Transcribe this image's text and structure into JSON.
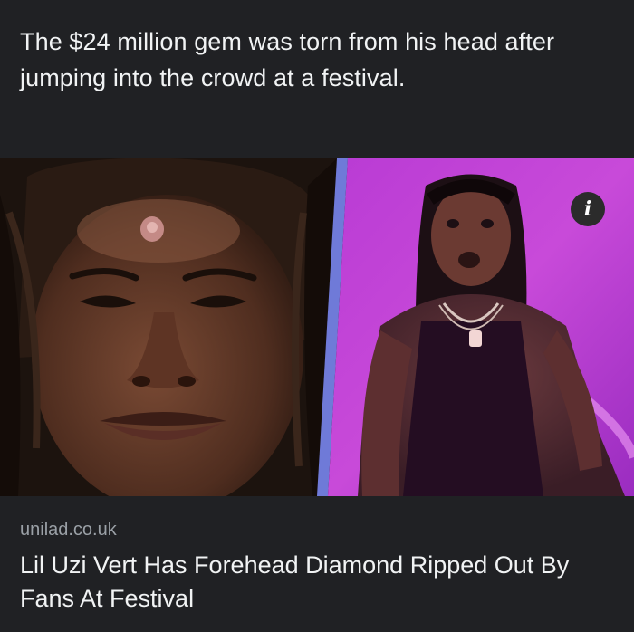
{
  "post": {
    "caption": "The $24 million gem was torn from his head after jumping into the crowd at a festival."
  },
  "link_preview": {
    "source": "unilad.co.uk",
    "headline": "Lil Uzi Vert Has Forehead Diamond Ripped Out By Fans At Festival",
    "info_icon": "info-icon"
  },
  "colors": {
    "background": "#202124",
    "right_photo_backdrop": "#c23fd6",
    "source_text": "#9aa0a6"
  }
}
